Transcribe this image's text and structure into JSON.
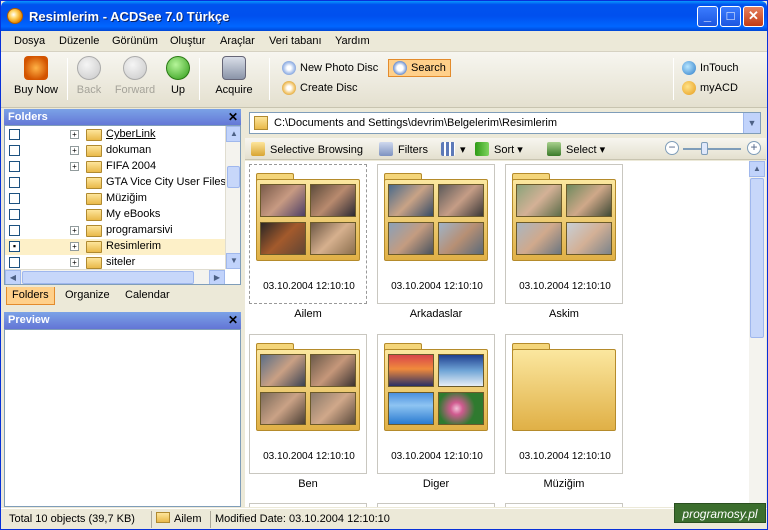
{
  "window": {
    "title": "Resimlerim - ACDSee 7.0 Türkçe",
    "controls": {
      "minimize": "_",
      "maximize": "□",
      "close": "✕"
    }
  },
  "menu": [
    "Dosya",
    "Düzenle",
    "Görünüm",
    "Oluştur",
    "Araçlar",
    "Veri tabanı",
    "Yardım"
  ],
  "toolbar": {
    "buy_now": "Buy Now",
    "back": "Back",
    "forward": "Forward",
    "up": "Up",
    "acquire": "Acquire",
    "new_photo_disc": "New Photo Disc",
    "create_disc": "Create Disc",
    "search": "Search",
    "intouch": "InTouch",
    "myacd": "myACD"
  },
  "folders_pane": {
    "title": "Folders",
    "close": "✕",
    "items": [
      {
        "label": "CyberLink",
        "expandable": true,
        "checked": false
      },
      {
        "label": "dokuman",
        "expandable": true,
        "checked": false
      },
      {
        "label": "FIFA 2004",
        "expandable": true,
        "checked": false
      },
      {
        "label": "GTA Vice City User Files",
        "expandable": false,
        "checked": false
      },
      {
        "label": "Müziğim",
        "expandable": false,
        "checked": false
      },
      {
        "label": "My eBooks",
        "expandable": false,
        "checked": false
      },
      {
        "label": "programarsivi",
        "expandable": true,
        "checked": false
      },
      {
        "label": "Resimlerim",
        "expandable": true,
        "checked": true
      },
      {
        "label": "siteler",
        "expandable": true,
        "checked": false
      }
    ]
  },
  "left_tabs": [
    "Folders",
    "Organize",
    "Calendar"
  ],
  "preview_pane": {
    "title": "Preview",
    "close": "✕"
  },
  "path": "C:\\Documents and Settings\\devrim\\Belgelerim\\Resimlerim",
  "viewbar": {
    "selective_browsing": "Selective Browsing",
    "filters": "Filters",
    "sort": "Sort",
    "select": "Select"
  },
  "thumbnails": [
    {
      "name": "Ailem",
      "date": "03.10.2004 12:10:10"
    },
    {
      "name": "Arkadaslar",
      "date": "03.10.2004 12:10:10"
    },
    {
      "name": "Askim",
      "date": "03.10.2004 12:10:10"
    },
    {
      "name": "Ben",
      "date": "03.10.2004 12:10:10"
    },
    {
      "name": "Diger",
      "date": "03.10.2004 12:10:10"
    },
    {
      "name": "Müziğim",
      "date": "03.10.2004 12:10:10"
    }
  ],
  "status": {
    "total": "Total 10 objects  (39,7 KB)",
    "folder": "Ailem",
    "modified": "Modified Date: 03.10.2004 12:10:10"
  },
  "watermark": "programosy.pl",
  "colors": {
    "titlebar": "#0053EE",
    "search_highlight": "#ffd08a",
    "folder": "#e9b94a",
    "pane_header": "#6375d6"
  }
}
